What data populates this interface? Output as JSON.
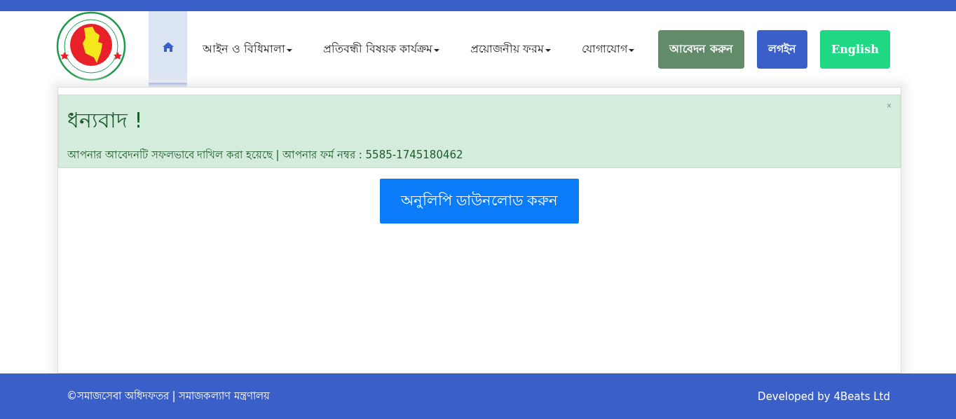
{
  "nav": {
    "items": [
      {
        "kind": "home",
        "selected": true
      },
      {
        "kind": "dropdown",
        "label": "আইন ও বিধিমালা",
        "selected": false
      },
      {
        "kind": "dropdown",
        "label": "প্রতিবন্ধী বিষয়ক কার্যক্রম",
        "selected": false
      },
      {
        "kind": "dropdown",
        "label": "প্রয়োজনীয় ফরম",
        "selected": false
      },
      {
        "kind": "dropdown",
        "label": "যোগাযোগ",
        "selected": false
      }
    ],
    "buttons": [
      {
        "label": "আবেদন করুন",
        "color": "#628b6a"
      },
      {
        "label": "লগইন",
        "color": "#3a5fc8"
      },
      {
        "label": "English",
        "color": "#1fd884"
      }
    ]
  },
  "alert": {
    "title": "ধন্যবাদ !",
    "message": "আপনার আবেদনটি সফলভাবে দাখিল করা হয়েছে | আপনার ফর্ম নম্বর : 5585-1745180462",
    "close": "×"
  },
  "download_button": "অনুলিপি ডাউনলোড করুন",
  "footer": {
    "copyright": "©সমাজসেবা অধিদফতর | সমাজকল্যাণ মন্ত্রণালয়",
    "credit": "Developed by 4Beats Ltd"
  }
}
